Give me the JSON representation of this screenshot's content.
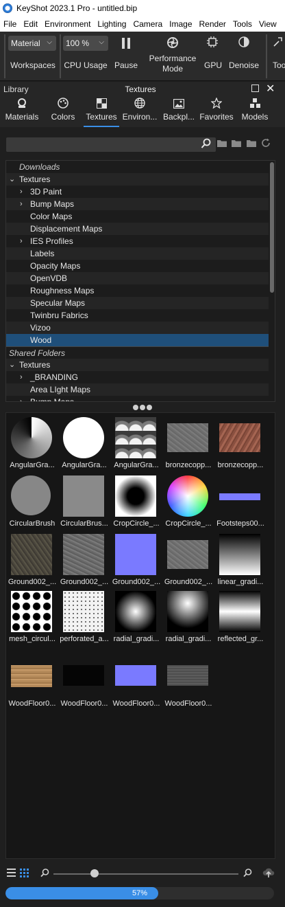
{
  "window": {
    "title": "KeyShot 2023.1 Pro  - untitled.bip"
  },
  "menu": [
    "File",
    "Edit",
    "Environment",
    "Lighting",
    "Camera",
    "Image",
    "Render",
    "Tools",
    "View"
  ],
  "toolbar": {
    "workspace_select": "Material",
    "cpu_select": "100 %",
    "workspaces_label": "Workspaces",
    "cpu_usage_label": "CPU Usage",
    "pause_label": "Pause",
    "performance_label_line1": "Performance",
    "performance_label_line2": "Mode",
    "gpu_label": "GPU",
    "denoise_label": "Denoise",
    "tools_label_partial": "Too"
  },
  "panel": {
    "library_label": "Library",
    "title": "Textures"
  },
  "tabs": [
    {
      "label": "Materials",
      "icon": "material-ball-icon"
    },
    {
      "label": "Colors",
      "icon": "palette-icon"
    },
    {
      "label": "Textures",
      "icon": "checker-icon",
      "active": true
    },
    {
      "label": "Environ...",
      "icon": "globe-icon"
    },
    {
      "label": "Backpl...",
      "icon": "image-icon"
    },
    {
      "label": "Favorites",
      "icon": "star-icon"
    },
    {
      "label": "Models",
      "icon": "cubes-icon"
    }
  ],
  "search": {
    "value": "",
    "placeholder": ""
  },
  "tree": {
    "rows": [
      {
        "label": "Downloads",
        "section": true
      },
      {
        "label": "Textures",
        "expanded": true,
        "level": 0
      },
      {
        "label": "3D Paint",
        "collapsed": true,
        "level": 1
      },
      {
        "label": "Bump Maps",
        "collapsed": true,
        "level": 1
      },
      {
        "label": "Color Maps",
        "level": 1
      },
      {
        "label": "Displacement Maps",
        "level": 1
      },
      {
        "label": "IES Profiles",
        "collapsed": true,
        "level": 1
      },
      {
        "label": "Labels",
        "level": 1
      },
      {
        "label": "Opacity Maps",
        "level": 1
      },
      {
        "label": "OpenVDB",
        "level": 1
      },
      {
        "label": "Roughness Maps",
        "level": 1
      },
      {
        "label": "Specular Maps",
        "level": 1
      },
      {
        "label": "Twinbru Fabrics",
        "level": 1
      },
      {
        "label": "Vizoo",
        "level": 1
      },
      {
        "label": "Wood",
        "level": 1,
        "selected": true
      },
      {
        "label": "Shared Folders",
        "section": true
      },
      {
        "label": "Textures",
        "expanded": true,
        "level": 0
      },
      {
        "label": "_BRANDING",
        "collapsed": true,
        "level": 1
      },
      {
        "label": "Area LIght Maps",
        "level": 1
      },
      {
        "label": "Bump Maps",
        "collapsed": true,
        "level": 1
      }
    ]
  },
  "thumbnails": [
    {
      "label": "AngularGra...",
      "kind": "angular1"
    },
    {
      "label": "AngularGra...",
      "kind": "circle-white"
    },
    {
      "label": "AngularGra...",
      "kind": "scales"
    },
    {
      "label": "bronzecopp...",
      "kind": "grey-noise"
    },
    {
      "label": "bronzecopp...",
      "kind": "copper"
    },
    {
      "label": "CircularBrush",
      "kind": "circle-grey"
    },
    {
      "label": "CircularBrus...",
      "kind": "grey-square"
    },
    {
      "label": "CropCircle_...",
      "kind": "radial-dark-center"
    },
    {
      "label": "CropCircle_...",
      "kind": "color-wheel"
    },
    {
      "label": "Footsteps00...",
      "kind": "blue-strip"
    },
    {
      "label": "Ground002_...",
      "kind": "ground-dark"
    },
    {
      "label": "Ground002_...",
      "kind": "ground-grey"
    },
    {
      "label": "Ground002_...",
      "kind": "normal-blue"
    },
    {
      "label": "Ground002_...",
      "kind": "grey-noise"
    },
    {
      "label": "linear_gradi...",
      "kind": "linear-gradient"
    },
    {
      "label": "mesh_circul...",
      "kind": "dots-black"
    },
    {
      "label": "perforated_a...",
      "kind": "perforated"
    },
    {
      "label": "radial_gradi...",
      "kind": "radial-soft"
    },
    {
      "label": "radial_gradi...",
      "kind": "radial-top"
    },
    {
      "label": "reflected_gr...",
      "kind": "reflected"
    },
    {
      "label": "WoodFloor0...",
      "kind": "wood-light"
    },
    {
      "label": "WoodFloor0...",
      "kind": "black-strip"
    },
    {
      "label": "WoodFloor0...",
      "kind": "normal-blue-strip"
    },
    {
      "label": "WoodFloor0...",
      "kind": "grey-strip"
    }
  ],
  "progress": {
    "value": 0.57,
    "label": "57%"
  },
  "colors": {
    "accent": "#3a8ee6",
    "selected_row": "#1f4f7a"
  }
}
